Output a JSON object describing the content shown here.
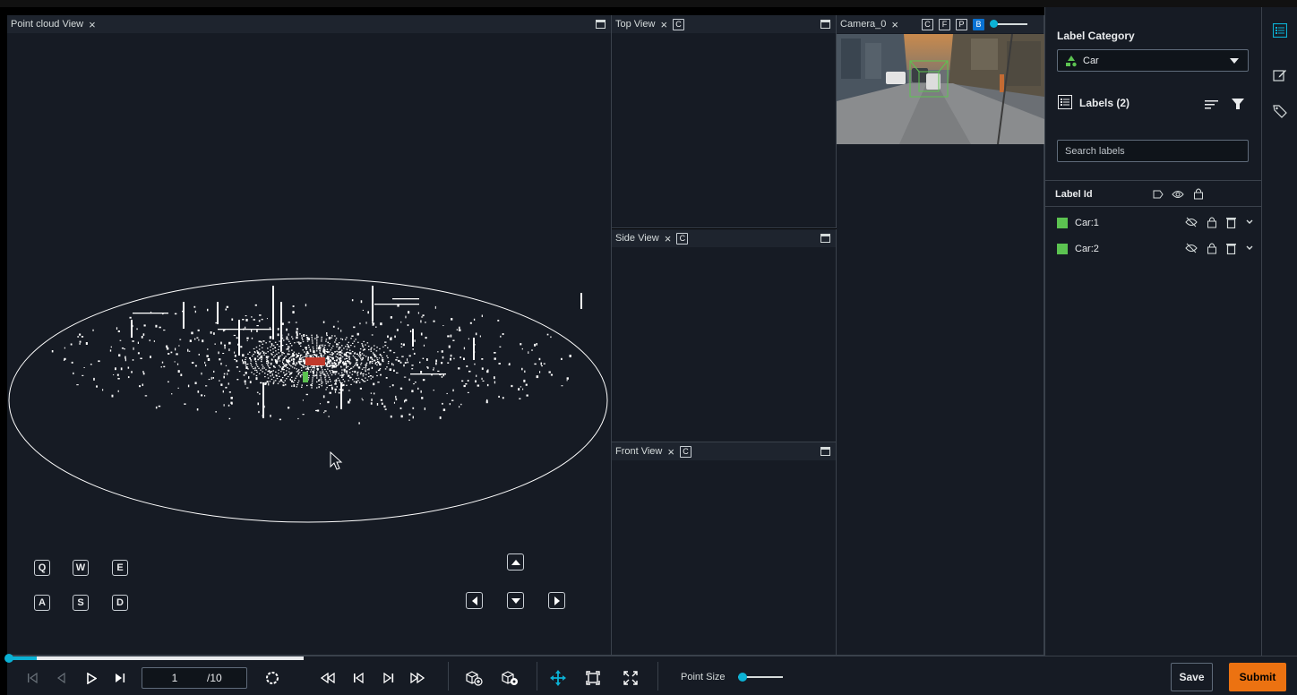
{
  "panels": {
    "point_cloud": {
      "title": "Point cloud View"
    },
    "top": {
      "title": "Top View",
      "key": "C"
    },
    "side": {
      "title": "Side View",
      "key": "C"
    },
    "front": {
      "title": "Front View",
      "key": "C"
    },
    "camera": {
      "title": "Camera_0",
      "keys": [
        "C",
        "F",
        "P",
        "B"
      ]
    }
  },
  "nav_keys": {
    "row1": [
      "Q",
      "W",
      "E"
    ],
    "row2": [
      "A",
      "S",
      "D"
    ]
  },
  "sidebar": {
    "category_label": "Label Category",
    "category_value": "Car",
    "labels_title": "Labels (2)",
    "search_placeholder": "Search labels",
    "column_header": "Label Id",
    "labels": [
      {
        "name": "Car:1",
        "color": "#5cc351"
      },
      {
        "name": "Car:2",
        "color": "#5cc351"
      }
    ]
  },
  "toolbar": {
    "frame_current": "1",
    "frame_total": "/10",
    "progress_fraction": 0.1,
    "point_size_label": "Point Size",
    "point_size_fraction": 0.1,
    "save_label": "Save",
    "submit_label": "Submit"
  },
  "colors": {
    "accent": "#0bb1d4",
    "submit": "#ec7211",
    "box_green": "#5cc351"
  }
}
